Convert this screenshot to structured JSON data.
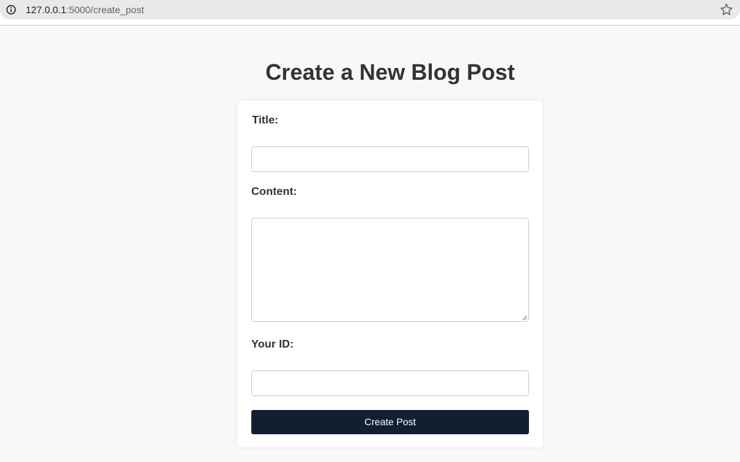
{
  "browser": {
    "url_host": "127.0.0.1",
    "url_path": ":5000/create_post",
    "info_icon": "info-icon",
    "bookmark_icon": "star-icon"
  },
  "page": {
    "title": "Create a New Blog Post"
  },
  "form": {
    "title_label": "Title:",
    "title_value": "",
    "title_placeholder": "",
    "content_label": "Content:",
    "content_value": "",
    "content_placeholder": "",
    "id_label": "Your ID:",
    "id_value": "",
    "id_placeholder": "",
    "submit_label": "Create Post"
  },
  "colors": {
    "page_background": "#f7f8fa",
    "button_background": "#121f30",
    "button_text": "#ffffff",
    "heading_text": "#333333"
  }
}
